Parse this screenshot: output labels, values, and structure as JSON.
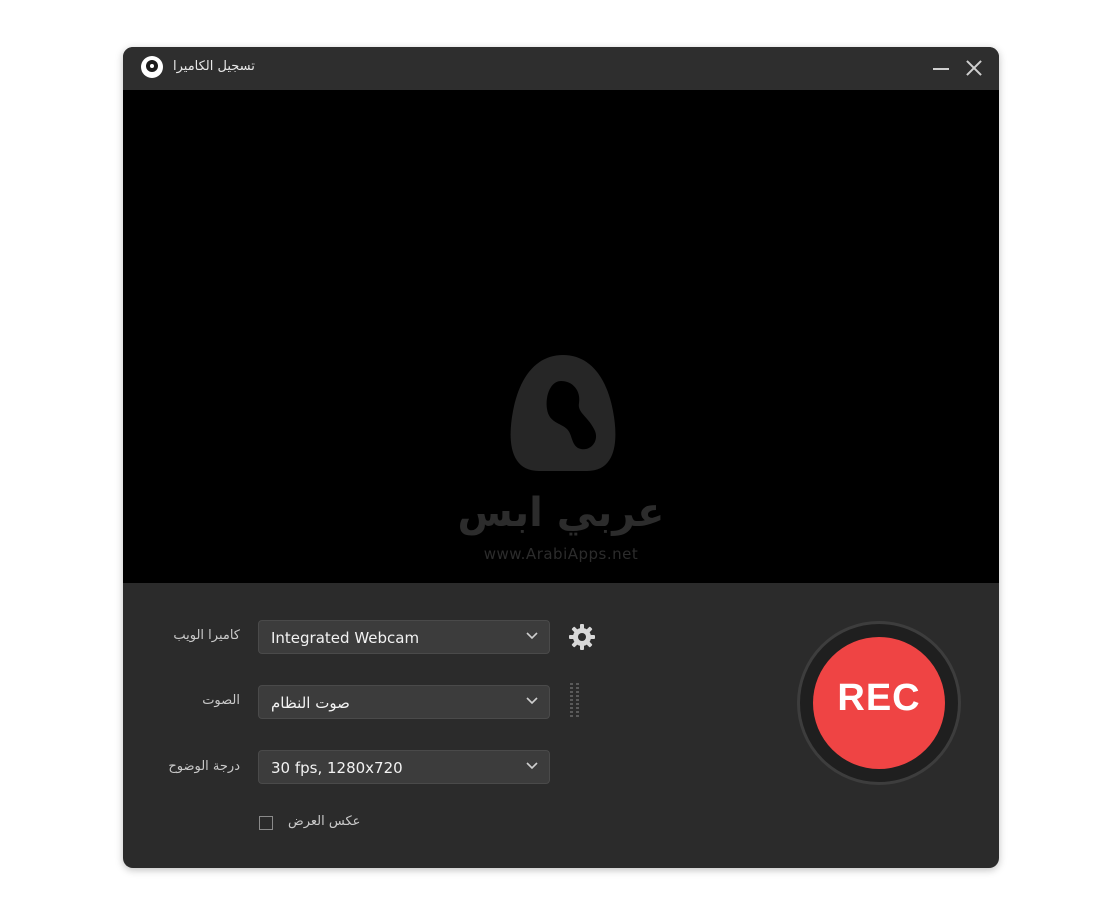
{
  "window": {
    "title": "تسجيل الكاميرا"
  },
  "preview": {
    "watermark_text": "عربي ابس",
    "watermark_url": "www.ArabiApps.net"
  },
  "controls": {
    "webcam": {
      "label": "كاميرا الويب",
      "value": "Integrated Webcam"
    },
    "audio": {
      "label": "الصوت",
      "value": "صوت النظام"
    },
    "resolution": {
      "label": "درجة الوضوح",
      "value": "30 fps, 1280x720"
    },
    "mirror": {
      "label": "عكس العرض",
      "checked": false
    }
  },
  "record": {
    "label": "REC"
  },
  "colors": {
    "rec": "#ef4444",
    "panel": "#2b2b2b",
    "preview": "#000000"
  },
  "icons": [
    "app-icon",
    "minimize-icon",
    "close-icon",
    "chevron-down-icon",
    "gear-icon",
    "audio-level-icon"
  ]
}
